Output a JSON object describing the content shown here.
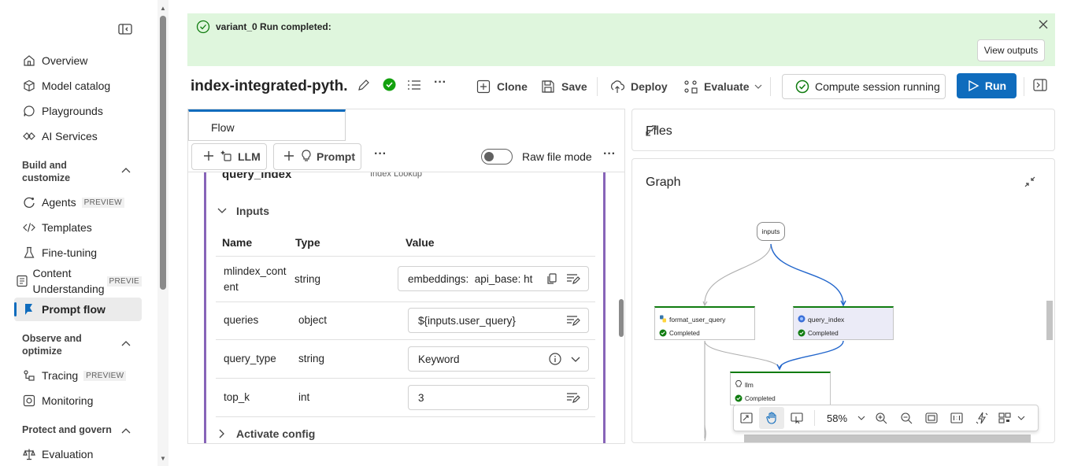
{
  "sidebar": {
    "items": [
      {
        "label": "Overview",
        "icon": "home-icon"
      },
      {
        "label": "Model catalog",
        "icon": "cube-icon"
      },
      {
        "label": "Playgrounds",
        "icon": "chat-icon"
      },
      {
        "label": "AI Services",
        "icon": "services-icon"
      },
      {
        "label": "Agents",
        "icon": "agents-icon",
        "badge": "PREVIEW"
      },
      {
        "label": "Templates",
        "icon": "code-icon"
      },
      {
        "label": "Fine-tuning",
        "icon": "flask-icon"
      },
      {
        "label": "Content Understanding",
        "icon": "document-icon",
        "badge": "PREVIE"
      },
      {
        "label": "Prompt flow",
        "icon": "prompt-flow-icon"
      },
      {
        "label": "Tracing",
        "icon": "tracing-icon",
        "badge": "PREVIEW"
      },
      {
        "label": "Monitoring",
        "icon": "monitor-icon"
      },
      {
        "label": "Evaluation",
        "icon": "scale-icon"
      }
    ],
    "sections": {
      "build": "Build and customize",
      "observe": "Observe and optimize",
      "protect": "Protect and govern"
    }
  },
  "banner": {
    "message": "variant_0 Run completed:",
    "view_outputs": "View outputs"
  },
  "toolbar": {
    "flow_title": "index-integrated-pyth...",
    "clone": "Clone",
    "save": "Save",
    "deploy": "Deploy",
    "evaluate": "Evaluate",
    "compute": "Compute session running",
    "run": "Run"
  },
  "flow_tab": "Flow",
  "node_toolbar": {
    "llm": "LLM",
    "prompt": "Prompt",
    "raw_file_mode": "Raw file mode"
  },
  "node": {
    "name": "query_index",
    "tool": "Index Lookup",
    "inputs_label": "Inputs",
    "columns": {
      "name": "Name",
      "type": "Type",
      "value": "Value"
    },
    "rows": [
      {
        "name": "mlindex_cont ent",
        "type": "string",
        "value": "embeddings:  api_base: ht"
      },
      {
        "name": "queries",
        "type": "object",
        "value": "${inputs.user_query}"
      },
      {
        "name": "query_type",
        "type": "string",
        "value": "Keyword"
      },
      {
        "name": "top_k",
        "type": "int",
        "value": "3"
      }
    ],
    "activate_config": "Activate config"
  },
  "files_panel": {
    "title": "Files"
  },
  "graph": {
    "title": "Graph",
    "input_node": "inputs",
    "nodes": [
      {
        "name": "format_user_query",
        "status": "Completed"
      },
      {
        "name": "query_index",
        "status": "Completed"
      },
      {
        "name": "llm",
        "status": "Completed"
      }
    ],
    "zoom": "58%",
    "colors": {
      "edge_active": "#2266cc",
      "edge_inactive": "#b0b0b0",
      "node_ok": "#107c10"
    }
  }
}
